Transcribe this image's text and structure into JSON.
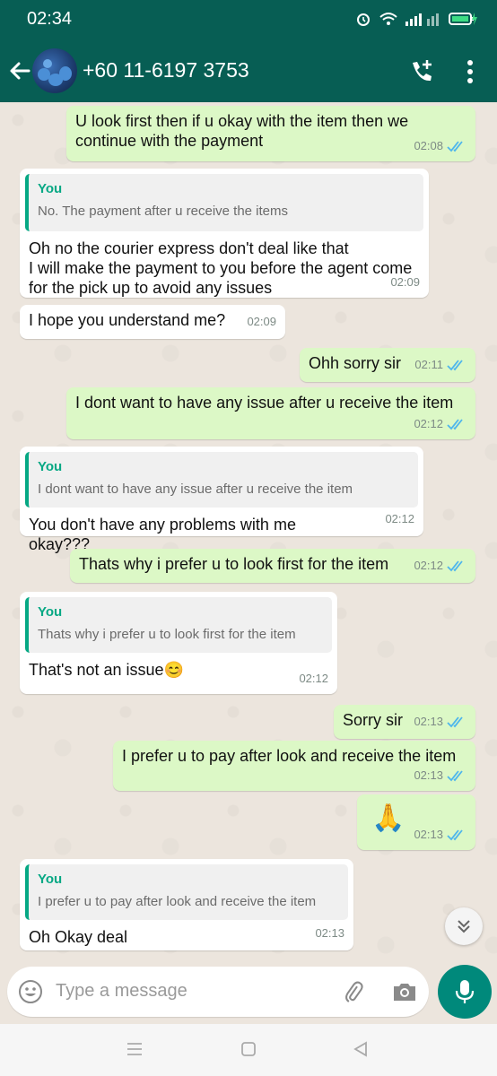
{
  "status": {
    "time": "02:34"
  },
  "header": {
    "title": "+60 11-6197 3753"
  },
  "messages": [
    {
      "type": "out",
      "text": "U look first then if u okay with the item then we continue with the payment",
      "time": "02:08"
    },
    {
      "type": "in",
      "reply_to": {
        "who": "You",
        "text": "No. The payment after u receive the items"
      },
      "text": "Oh no the courier express don't deal like that\nI will make the payment to you before the agent come for the pick up to avoid any issues",
      "time": "02:09"
    },
    {
      "type": "in",
      "text": "I hope you understand me?",
      "time": "02:09"
    },
    {
      "type": "out",
      "text": "Ohh sorry sir",
      "time": "02:11"
    },
    {
      "type": "out",
      "text": "I dont want to have any issue after u receive the item",
      "time": "02:12"
    },
    {
      "type": "in",
      "reply_to": {
        "who": "You",
        "text": "I dont want to have any issue after u receive the item"
      },
      "text": "You don't have any problems with me okay???",
      "time": "02:12"
    },
    {
      "type": "out",
      "text": "Thats why i prefer u to look first for the item",
      "time": "02:12"
    },
    {
      "type": "in",
      "reply_to": {
        "who": "You",
        "text": "Thats why i prefer u to look first for the item"
      },
      "text": "That's not an issue😊",
      "time": "02:12"
    },
    {
      "type": "out",
      "text": "Sorry sir",
      "time": "02:13"
    },
    {
      "type": "out",
      "text": "I prefer u to pay after look and receive the item",
      "time": "02:13"
    },
    {
      "type": "out",
      "text": "🙏",
      "time": "02:13"
    },
    {
      "type": "in",
      "reply_to": {
        "who": "You",
        "text": "I prefer u to pay after look and receive the item"
      },
      "text": "Oh Okay deal",
      "time": "02:13"
    }
  ],
  "input": {
    "placeholder": "Type a message"
  },
  "colors": {
    "header": "#075e54",
    "outgoing": "#dcf8c6",
    "incoming": "#ffffff",
    "accent": "#00897b",
    "tick_read": "#4fb6ec"
  },
  "icons": [
    "back-arrow-icon",
    "add-call-icon",
    "more-vert-icon",
    "emoji-icon",
    "attach-icon",
    "camera-icon",
    "mic-icon",
    "scroll-down-icon",
    "alarm-icon",
    "wifi-icon",
    "signal-icon",
    "battery-icon",
    "nav-menu-icon",
    "nav-home-icon",
    "nav-back-icon"
  ]
}
